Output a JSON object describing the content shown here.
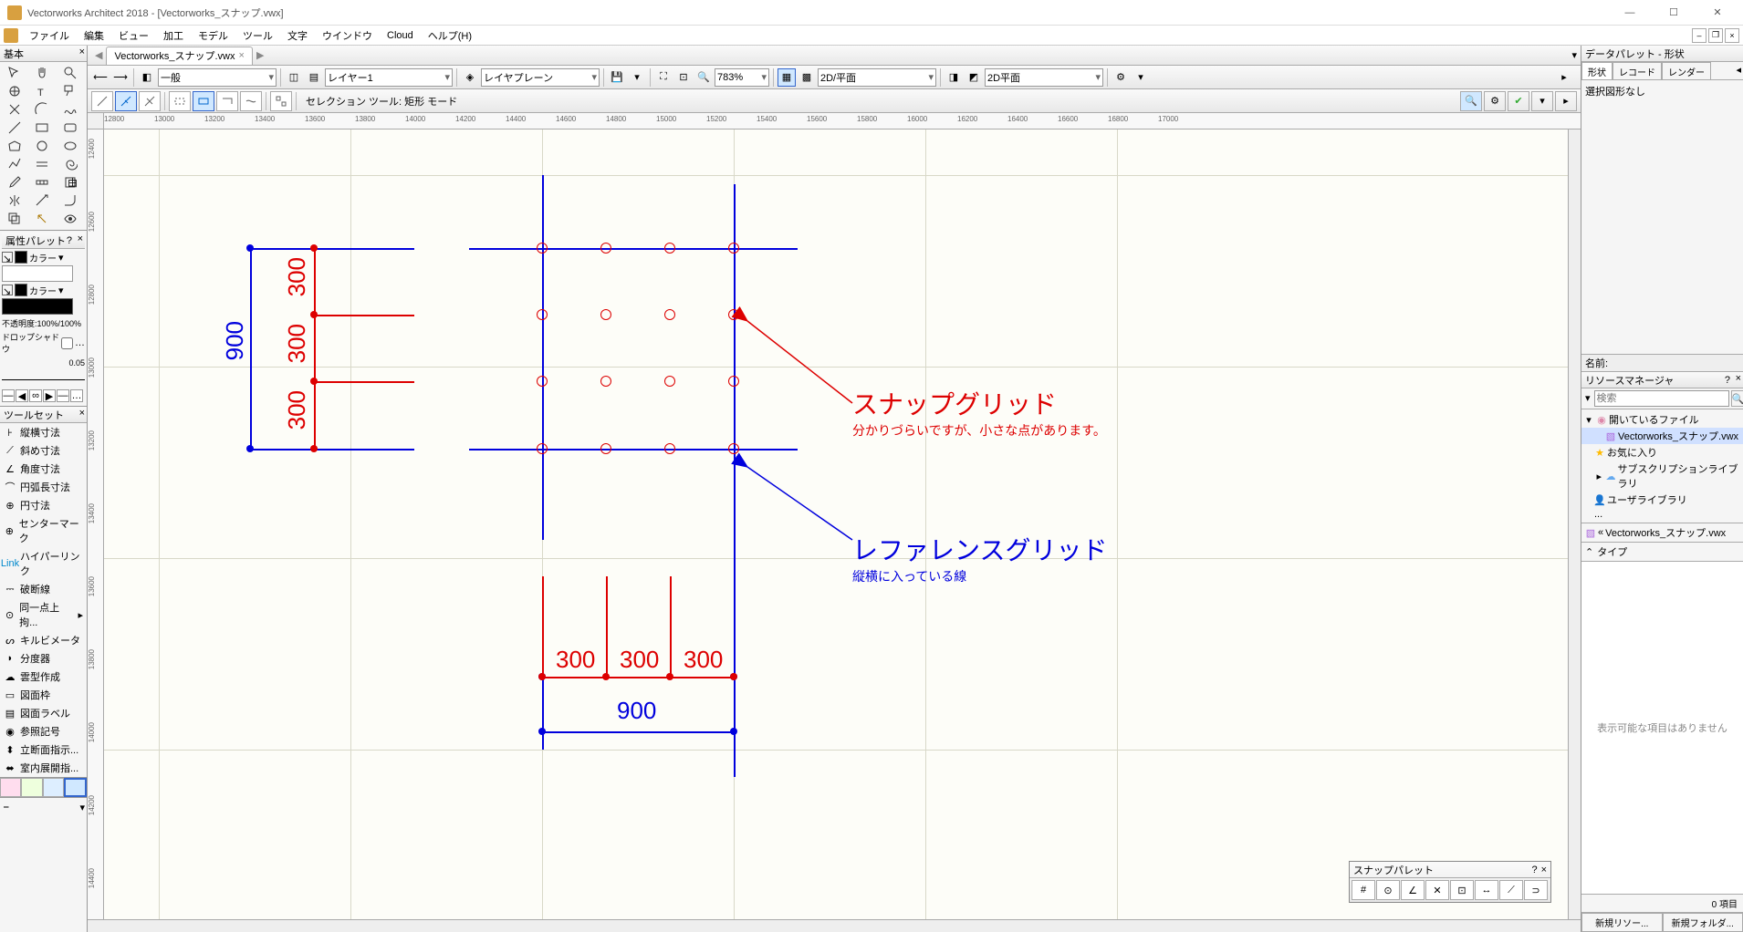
{
  "app": {
    "title": "Vectorworks Architect 2018 - [Vectorworks_スナップ.vwx]"
  },
  "menus": [
    "ファイル",
    "編集",
    "ビュー",
    "加工",
    "モデル",
    "ツール",
    "文字",
    "ウインドウ",
    "Cloud",
    "ヘルプ(H)"
  ],
  "basic_palette": {
    "title": "基本"
  },
  "attr_palette": {
    "title": "属性パレット",
    "color_label": "カラー",
    "opacity": "不透明度:100%/100%",
    "dropshadow": "ドロップシャドウ",
    "thickness": "0.05"
  },
  "toolset": {
    "title": "ツールセット",
    "items": [
      "縦横寸法",
      "斜め寸法",
      "角度寸法",
      "円弧長寸法",
      "円寸法",
      "センターマーク",
      "ハイパーリンク",
      "破断線",
      "同一点上拘...",
      "キルビメータ",
      "分度器",
      "雲型作成",
      "図面枠",
      "図面ラベル",
      "参照記号",
      "立断面指示...",
      "室内展開指..."
    ]
  },
  "doc": {
    "tab_name": "Vectorworks_スナップ.vwx"
  },
  "view_tb": {
    "class_dd": "一般",
    "layer_dd": "レイヤー1",
    "plane_dd": "レイヤプレーン",
    "zoom": "783%",
    "view_dd": "2D/平面",
    "render_dd": "2D平面"
  },
  "mode_bar": {
    "label": "セレクション ツール: 矩形 モード"
  },
  "ruler_h": [
    "12800",
    "13000",
    "13200",
    "13400",
    "13600",
    "13800",
    "14000",
    "14200",
    "14400",
    "14600",
    "14800",
    "15000",
    "15200",
    "15400",
    "15600",
    "15800",
    "16000",
    "16200",
    "16400",
    "16600",
    "16800",
    "17000"
  ],
  "ruler_v": [
    "12400",
    "12600",
    "12800",
    "13000",
    "13200",
    "13400",
    "13600",
    "13800",
    "14000",
    "14200",
    "14400"
  ],
  "dims": {
    "v300_1": "300",
    "v300_2": "300",
    "v300_3": "300",
    "v900": "900",
    "h300_1": "300",
    "h300_2": "300",
    "h300_3": "300",
    "h900": "900"
  },
  "annotations": {
    "snap_title": "スナップグリッド",
    "snap_sub": "分かりづらいですが、小さな点があります。",
    "ref_title": "レファレンスグリッド",
    "ref_sub": "縦横に入っている線"
  },
  "snap_palette": {
    "title": "スナップパレット"
  },
  "right": {
    "data_hdr": "データパレット - 形状",
    "tabs": [
      "形状",
      "レコード",
      "レンダー"
    ],
    "no_sel": "選択図形なし",
    "name_label": "名前:",
    "res_hdr": "リソースマネージャ",
    "search_ph": "検索",
    "tree": {
      "open_files": "開いているファイル",
      "doc": "Vectorworks_スナップ.vwx",
      "fav": "お気に入り",
      "sublib": "サブスクリプションライブラリ",
      "userlib": "ユーザライブラリ",
      "more": "..."
    },
    "bc_doc": "Vectorworks_スナップ.vwx",
    "type": "タイプ",
    "empty": "表示可能な項目はありません",
    "count": "0 項目",
    "new_res": "新規リソー...",
    "new_fold": "新規フォルダ..."
  }
}
